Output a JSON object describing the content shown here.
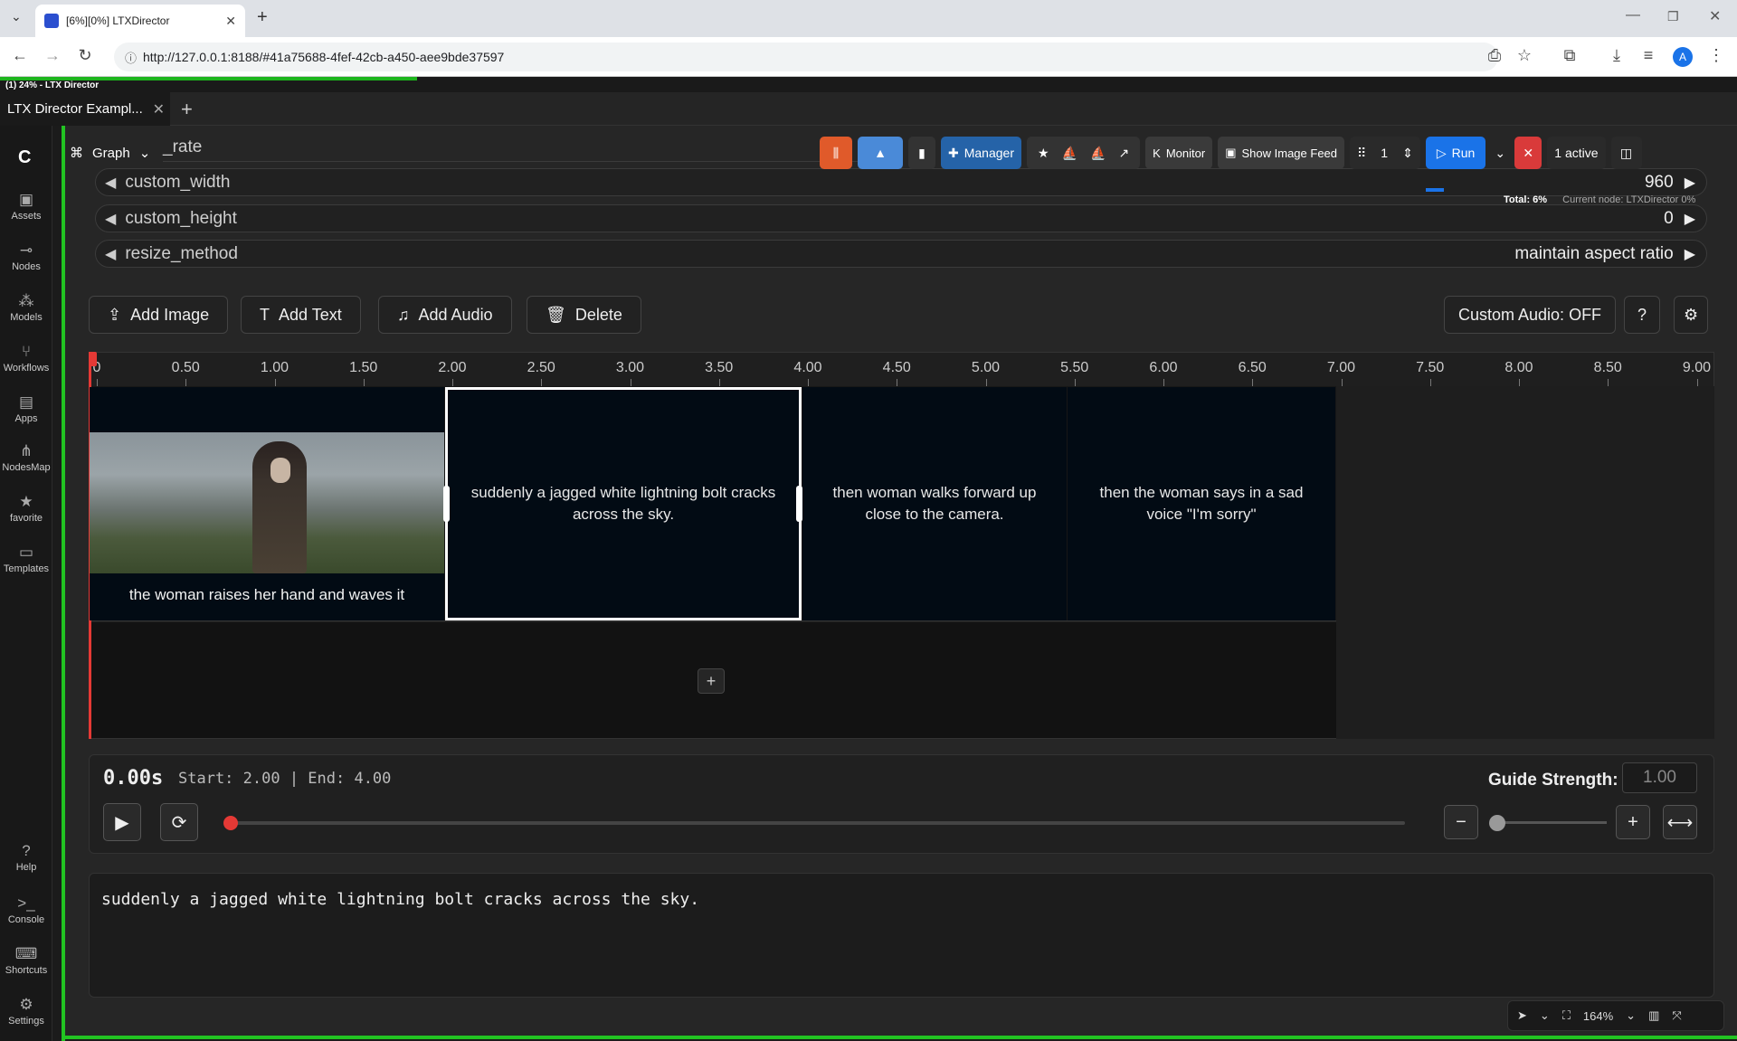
{
  "browser": {
    "tab_title": "[6%][0%] LTXDirector",
    "url": "http://127.0.0.1:8188/#41a75688-4fef-42cb-a450-aee9bde37597",
    "profile_letter": "A"
  },
  "app": {
    "progress_text": "(1) 24% - LTX Director",
    "progress_fraction": 0.24,
    "workflow_tab": "LTX Director Exampl...",
    "graph_label": "Graph",
    "partial_param": "_rate"
  },
  "sidebar": [
    {
      "label": "Assets",
      "icon": "assets-icon"
    },
    {
      "label": "Nodes",
      "icon": "nodes-icon"
    },
    {
      "label": "Models",
      "icon": "models-icon"
    },
    {
      "label": "Workflows",
      "icon": "workflows-icon"
    },
    {
      "label": "Apps",
      "icon": "apps-icon"
    },
    {
      "label": "NodesMap",
      "icon": "nodesmap-icon"
    },
    {
      "label": "favorite",
      "icon": "star-icon"
    },
    {
      "label": "Templates",
      "icon": "templates-icon"
    },
    {
      "label": "Help",
      "icon": "help-icon"
    },
    {
      "label": "Console",
      "icon": "console-icon"
    },
    {
      "label": "Shortcuts",
      "icon": "keyboard-icon"
    },
    {
      "label": "Settings",
      "icon": "gear-icon"
    }
  ],
  "toolbar": {
    "manager": "Manager",
    "monitor": "Monitor",
    "show_image_feed": "Show Image Feed",
    "queue_count": "1",
    "run": "Run",
    "active": "1 active"
  },
  "status": {
    "total": "Total: 6%",
    "current_node": "Current node: LTXDirector 0%"
  },
  "params": [
    {
      "name": "custom_width",
      "value": "960"
    },
    {
      "name": "custom_height",
      "value": "0"
    },
    {
      "name": "resize_method",
      "value": "maintain aspect ratio"
    }
  ],
  "actions": {
    "add_image": "Add Image",
    "add_text": "Add Text",
    "add_audio": "Add Audio",
    "delete": "Delete",
    "custom_audio": "Custom Audio: OFF",
    "help": "?"
  },
  "ruler_ticks": [
    "0",
    "0.50",
    "1.00",
    "1.50",
    "2.00",
    "2.50",
    "3.00",
    "3.50",
    "4.00",
    "4.50",
    "5.00",
    "5.50",
    "6.00",
    "6.50",
    "7.00",
    "7.50",
    "8.00",
    "8.50",
    "9.00"
  ],
  "clips": [
    {
      "text": "the woman raises her hand and waves it",
      "start": 0,
      "end": 2
    },
    {
      "text": "suddenly a jagged white lightning bolt cracks across the sky.",
      "start": 2,
      "end": 4
    },
    {
      "text": "then woman walks forward up close to the camera.",
      "start": 4,
      "end": 5.5
    },
    {
      "text": "then the woman says in a sad voice \"I'm sorry\"",
      "start": 5.5,
      "end": 7
    }
  ],
  "playback": {
    "current_time": "0.00s",
    "range": "Start: 2.00 | End: 4.00",
    "guide_label": "Guide Strength:",
    "guide_value": "1.00"
  },
  "prompt_text": "suddenly a jagged white lightning bolt cracks across the sky.",
  "zoom": "164%"
}
